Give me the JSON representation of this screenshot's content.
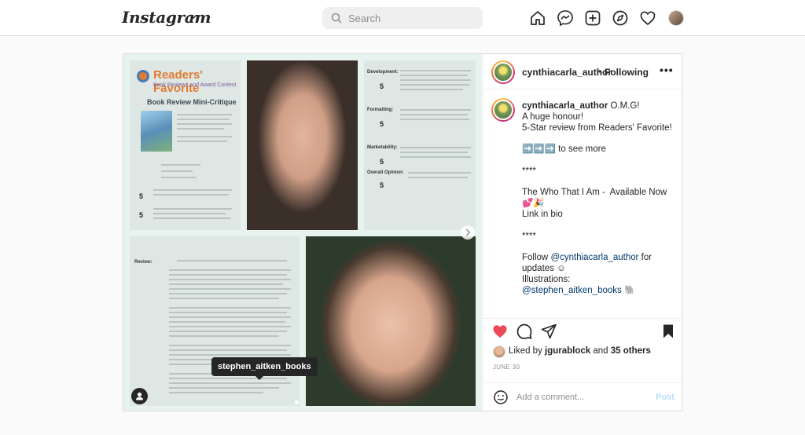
{
  "header": {
    "logo": "Instagram",
    "search_placeholder": "Search"
  },
  "post": {
    "author": "cynthiacarla_author",
    "follow_status": "Following",
    "more_label": "•••",
    "tooltip_tag": "stephen_aitken_books",
    "collage": {
      "doc1_title": "Readers' Favorite",
      "doc1_subtitle": "Book Reviews and Award Contest",
      "doc1_heading": "Book Review Mini-Critique",
      "scores": [
        "5",
        "5",
        "5",
        "5",
        "5",
        "5"
      ],
      "labels": [
        "Development:",
        "Formatting:",
        "Marketability:",
        "Overall Opinion:",
        "Review:"
      ]
    },
    "caption": {
      "author": "cynthiacarla_author",
      "line1": " O.M.G!",
      "line2": "A huge honour!",
      "line3": "5-Star review from Readers' Favorite!",
      "see_more_arrows": "➡️➡️➡️",
      "see_more": " to see more",
      "stars1": "****",
      "book_line": "The Who That I Am -  Available Now 💕🎉",
      "link_in_bio": "Link in bio",
      "stars2": "****",
      "follow_prefix": "Follow ",
      "follow_handle": "@cynthiacarla_author",
      "follow_suffix": " for updates ☺",
      "illustrations": "Illustrations:",
      "illustrator": "@stephen_aitken_books",
      "illustrator_emoji": " 🐘"
    },
    "liked_by_prefix": "Liked by ",
    "liked_by_user": "jgurablock",
    "liked_by_mid": " and ",
    "liked_by_others": "35 others",
    "date": "JUNE 30",
    "comment_placeholder": "Add a comment...",
    "post_button": "Post"
  },
  "colors": {
    "like_red": "#ed4956",
    "link_blue": "#00376b",
    "post_disabled": "#b2dffc"
  }
}
